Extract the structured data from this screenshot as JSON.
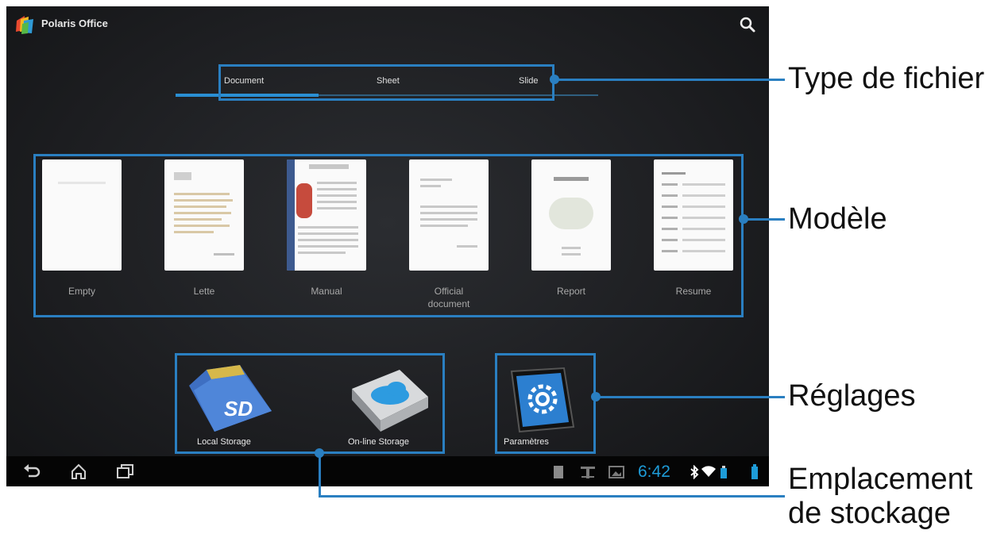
{
  "app": {
    "title": "Polaris Office"
  },
  "tabs": [
    {
      "label": "Document"
    },
    {
      "label": "Sheet"
    },
    {
      "label": "Slide"
    }
  ],
  "templates": [
    {
      "label": "Empty"
    },
    {
      "label": "Lette"
    },
    {
      "label": "Manual"
    },
    {
      "label_line1": "Official",
      "label_line2": "document"
    },
    {
      "label": "Report"
    },
    {
      "label": "Resume"
    }
  ],
  "storage": {
    "local": "Local Storage",
    "online": "On-line Storage",
    "settings": "Paramètres"
  },
  "status": {
    "time": "6:42"
  },
  "callouts": {
    "file_type": "Type de fichier",
    "template": "Modèle",
    "settings": "Réglages",
    "storage_line1": "Emplacement",
    "storage_line2": "de stockage"
  },
  "colors": {
    "accent": "#2a7fc1",
    "tab_active": "#2a8fd3",
    "clock": "#1e9cd8"
  }
}
